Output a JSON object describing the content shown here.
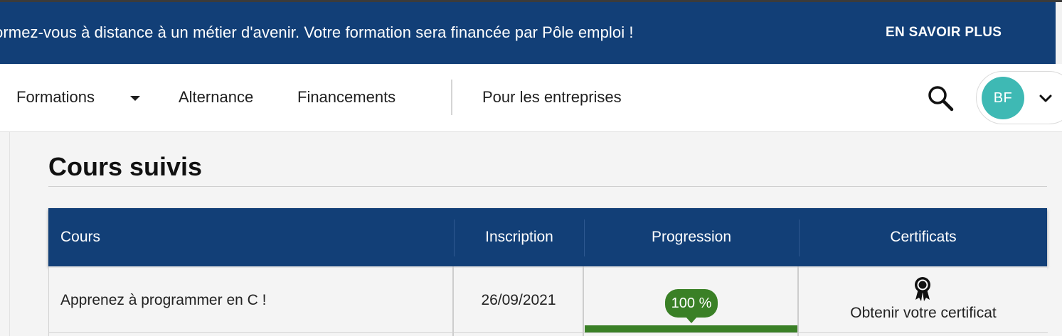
{
  "banner": {
    "message": "ormez-vous à distance à un métier d'avenir. Votre formation sera financée par Pôle emploi !",
    "cta": "EN SAVOIR PLUS"
  },
  "nav": {
    "items": [
      {
        "label": "Formations",
        "has_dropdown": true
      },
      {
        "label": "Alternance"
      },
      {
        "label": "Financements"
      },
      {
        "label": "Pour les entreprises"
      }
    ],
    "search_icon": "search-icon",
    "user": {
      "initials": "BF",
      "avatar_color": "#3eb9b4",
      "menu_icon": "chevron-down-icon"
    }
  },
  "page": {
    "title": "Cours suivis"
  },
  "table": {
    "headers": [
      "Cours",
      "Inscription",
      "Progression",
      "Certificats"
    ],
    "rows": [
      {
        "course": "Apprenez à programmer en C !",
        "enrolled": "26/09/2021",
        "progress_label": "100 %",
        "progress": 1.0,
        "certificate_icon": "award-ribbon-icon",
        "certificate_link": "Obtenir votre certificat"
      }
    ]
  },
  "colors": {
    "brand_navy": "#123f77",
    "progress_green": "#3a8026",
    "avatar_teal": "#3eb9b4"
  }
}
